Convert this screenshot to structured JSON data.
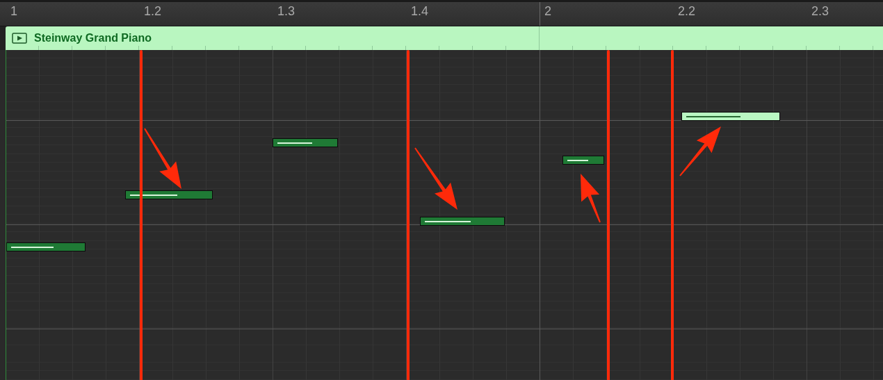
{
  "ruler": {
    "labels": [
      "1",
      "1.2",
      "1.3",
      "1.4",
      "2",
      "2.2",
      "2.3"
    ]
  },
  "region": {
    "title": "Steinway Grand Piano"
  },
  "notes": [
    {
      "selected": false
    },
    {
      "selected": false
    },
    {
      "selected": false
    },
    {
      "selected": false
    },
    {
      "selected": false
    },
    {
      "selected": true
    }
  ]
}
